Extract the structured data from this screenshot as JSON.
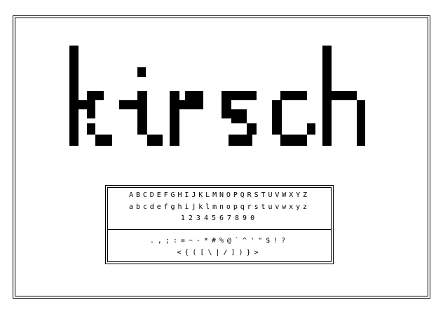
{
  "title": "kirsch",
  "specimen": {
    "uppercase": "ABCDEFGHIJKLMNOPQRSTUVWXYZ",
    "lowercase": "abcdefghijklmnopqrstuvwxyz",
    "numerals": "1234567890",
    "punctuation": ".,;:=~-*#%@`^'\"$!?",
    "brackets": "<{([\\|/])}>"
  },
  "colors": {
    "ink": "#000000",
    "paper": "#ffffff"
  }
}
